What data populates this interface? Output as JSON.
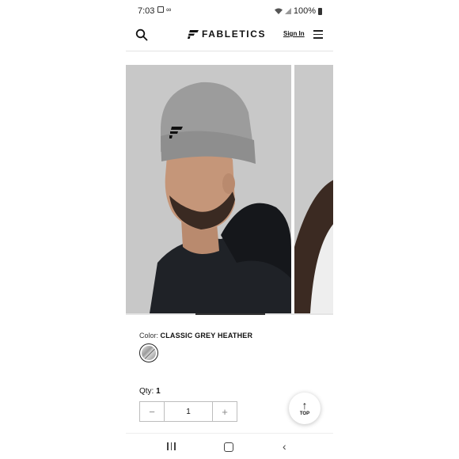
{
  "status_bar": {
    "time": "7:03",
    "left_icons": [
      "image-icon",
      "link-icon"
    ],
    "right_icons": [
      "wifi-icon",
      "signal-icon"
    ],
    "battery_percent": "100%"
  },
  "header": {
    "brand": "FABLETICS",
    "signin_label": "Sign In",
    "icons": [
      "search-icon",
      "fabletics-logo-icon",
      "menu-icon"
    ]
  },
  "gallery": {
    "images": [
      "man-grey-beanie-photo",
      "woman-partial-photo"
    ],
    "active_index": 0
  },
  "product": {
    "color_label": "Color:",
    "color_value": "CLASSIC GREY HEATHER",
    "qty_label": "Qty:",
    "qty_value": "1",
    "stepper_minus": "−",
    "stepper_value": "1",
    "stepper_plus": "+"
  },
  "top_button": {
    "label": "TOP",
    "icon": "arrow-up-icon"
  },
  "nav_bar": {
    "icons": [
      "recent-apps-icon",
      "home-icon",
      "back-icon"
    ]
  },
  "colors": {
    "background": "#ffffff",
    "text": "#111111",
    "divider": "#e3e3e3",
    "photo_bg": "#c9c9c9"
  }
}
